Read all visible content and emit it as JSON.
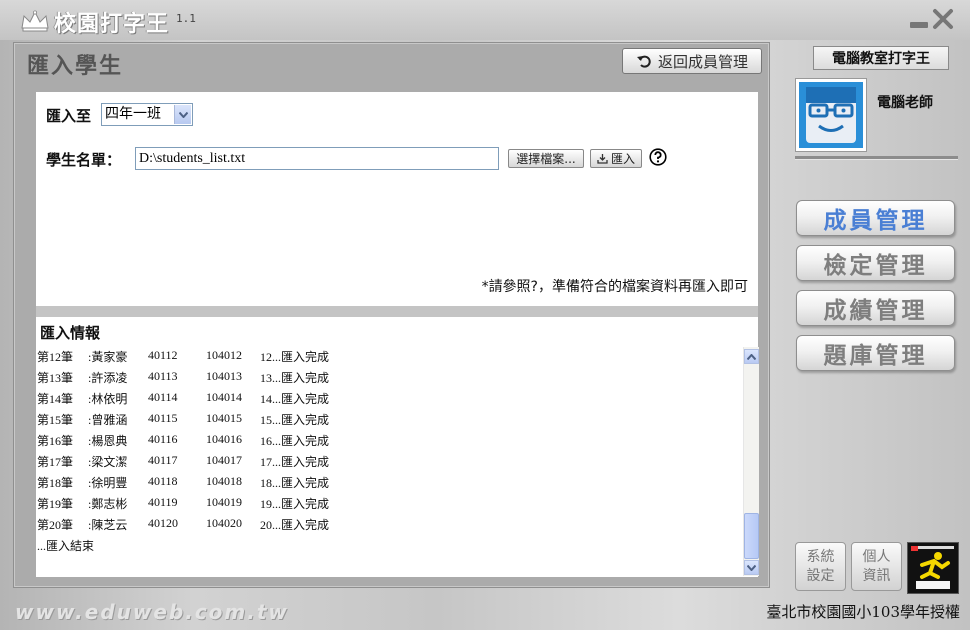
{
  "app": {
    "title": "校園打字王",
    "version": "1.1"
  },
  "panel": {
    "title": "匯入學生",
    "back_button": "返回成員管理"
  },
  "form": {
    "import_to_label": "匯入至",
    "class_selected": "四年一班",
    "student_list_label": "學生名單：",
    "file_path": "D:\\students_list.txt",
    "browse_button": "選擇檔案...",
    "import_button": "匯入",
    "note": "*請參照?，準備符合的檔案資料再匯入即可"
  },
  "info": {
    "title": "匯入情報",
    "lines": [
      {
        "no": "第12筆",
        "name": ":黃家豪",
        "id": "40112",
        "code": "104012",
        "status": "12...匯入完成"
      },
      {
        "no": "第13筆",
        "name": ":許添凌",
        "id": "40113",
        "code": "104013",
        "status": "13...匯入完成"
      },
      {
        "no": "第14筆",
        "name": ":林依明",
        "id": "40114",
        "code": "104014",
        "status": "14...匯入完成"
      },
      {
        "no": "第15筆",
        "name": ":曾雅涵",
        "id": "40115",
        "code": "104015",
        "status": "15...匯入完成"
      },
      {
        "no": "第16筆",
        "name": ":楊恩典",
        "id": "40116",
        "code": "104016",
        "status": "16...匯入完成"
      },
      {
        "no": "第17筆",
        "name": ":梁文潔",
        "id": "40117",
        "code": "104017",
        "status": "17...匯入完成"
      },
      {
        "no": "第18筆",
        "name": ":徐明豐",
        "id": "40118",
        "code": "104018",
        "status": "18...匯入完成"
      },
      {
        "no": "第19筆",
        "name": ":鄭志彬",
        "id": "40119",
        "code": "104019",
        "status": "19...匯入完成"
      },
      {
        "no": "第20筆",
        "name": ":陳芝云",
        "id": "40120",
        "code": "104020",
        "status": "20...匯入完成"
      }
    ],
    "end_line": "...匯入結束"
  },
  "sidebar": {
    "lab_title": "電腦教室打字王",
    "user_name": "電腦老師",
    "nav": [
      {
        "label": "成員管理",
        "active": true
      },
      {
        "label": "檢定管理",
        "active": false
      },
      {
        "label": "成績管理",
        "active": false
      },
      {
        "label": "題庫管理",
        "active": false
      }
    ],
    "system_settings": [
      "系統",
      "設定"
    ],
    "personal_info": [
      "個人",
      "資訊"
    ]
  },
  "footer": {
    "url": "www.eduweb.com.tw",
    "license": "臺北市校園國小103學年授權"
  },
  "colors": {
    "active_nav": "#4a7fd4",
    "inactive_nav": "#7e7e7e",
    "avatar_bg": "#2a8fd8"
  }
}
